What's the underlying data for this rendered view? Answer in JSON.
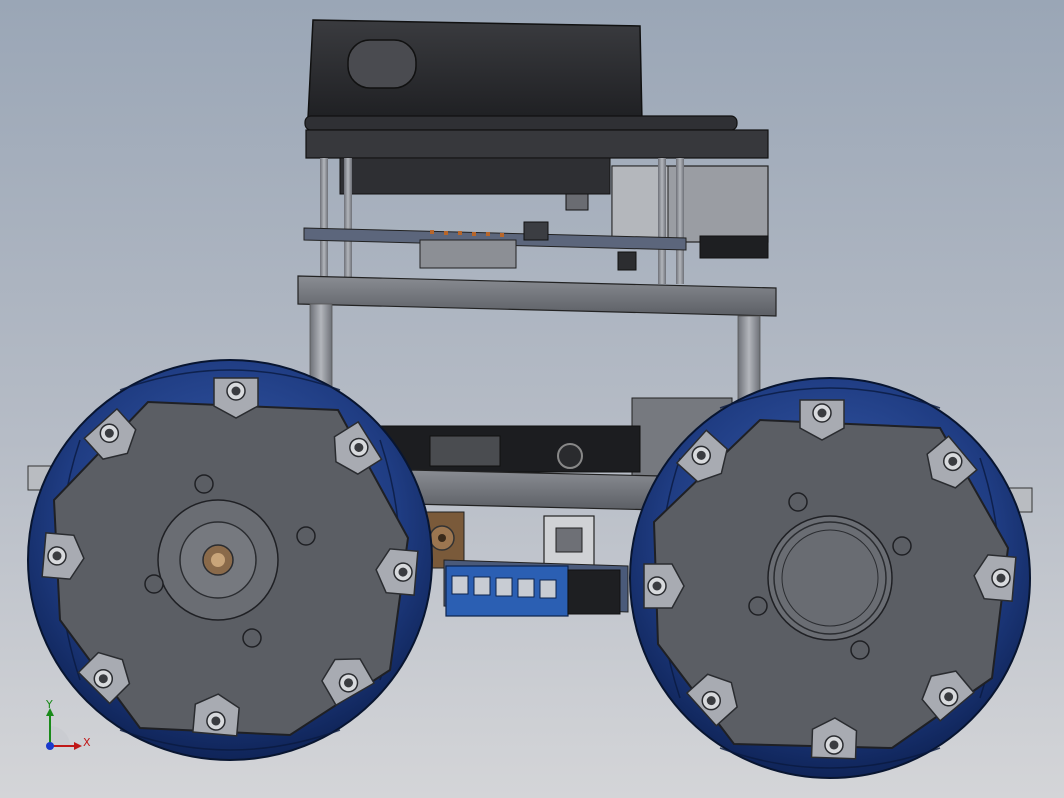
{
  "scene": {
    "subject": "robot-chassis-assembly",
    "background_top": "#9aa6b6",
    "background_bottom": "#d4d5d8"
  },
  "colors": {
    "wheel_roller": "#1f3c82",
    "wheel_roller_dark": "#0f2458",
    "hub_plate": "#5b5e64",
    "mount_tab": "#a8abb2",
    "frame_plate": "#6e7177",
    "pcb": "#4a5a7a",
    "standoff": "#8b8f96",
    "sensor_body": "#2b2c2f",
    "terminal_block": "#2b5fb3"
  },
  "triad": {
    "y_label": "Y",
    "x_label": "X",
    "icon": "coordinate-triad-icon"
  }
}
